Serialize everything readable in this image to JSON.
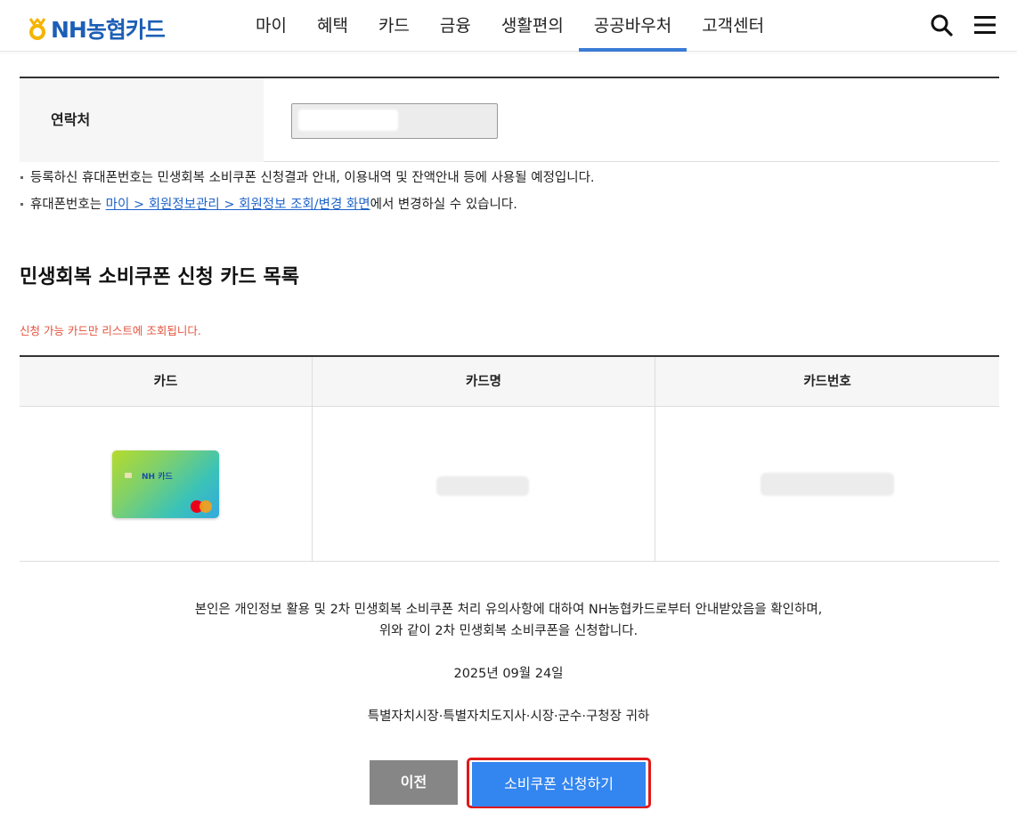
{
  "header": {
    "logo_text": "NH농협카드",
    "nav": [
      "마이",
      "혜택",
      "카드",
      "금융",
      "생활편의",
      "공공바우처",
      "고객센터"
    ],
    "active_nav_index": 5,
    "colors": {
      "brand_blue": "#1c5fb6",
      "accent": "#3a7bd5",
      "logo_gold": "#f4b400"
    }
  },
  "contact": {
    "label": "연락처",
    "notes": [
      "등록하신 휴대폰번호는 민생회복 소비쿠폰 신청결과 안내, 이용내역 및 잔액안내 등에 사용될 예정입니다."
    ],
    "note2_prefix": "휴대폰번호는 ",
    "note2_link": "마이 > 회원정보관리 > 회원정보 조회/변경 화면",
    "note2_suffix": "에서 변경하실 수 있습니다."
  },
  "card_section": {
    "title": "민생회복 소비쿠폰 신청 카드 목록",
    "sub_note": "신청 가능 카드만 리스트에 조회됩니다.",
    "columns": [
      "카드",
      "카드명",
      "카드번호"
    ],
    "card_brand_text": "NH 카드",
    "colors": {
      "sub_note": "#e5533d"
    }
  },
  "confirm": {
    "line1": "본인은 개인정보 활용 및 2차 민생회복 소비쿠폰 처리 유의사항에 대하여 NH농협카드로부터 안내받았음을 확인하며,",
    "line2": "위와 같이 2차 민생회복 소비쿠폰을 신청합니다.",
    "date": "2025년 09월 24일",
    "recipient": "특별자치시장·특별자치도지사·시장·군수·구청장 귀하"
  },
  "buttons": {
    "prev": "이전",
    "apply": "소비쿠폰 신청하기",
    "colors": {
      "prev": "#868686",
      "apply": "#3385f0",
      "highlight": "#e01919"
    }
  }
}
